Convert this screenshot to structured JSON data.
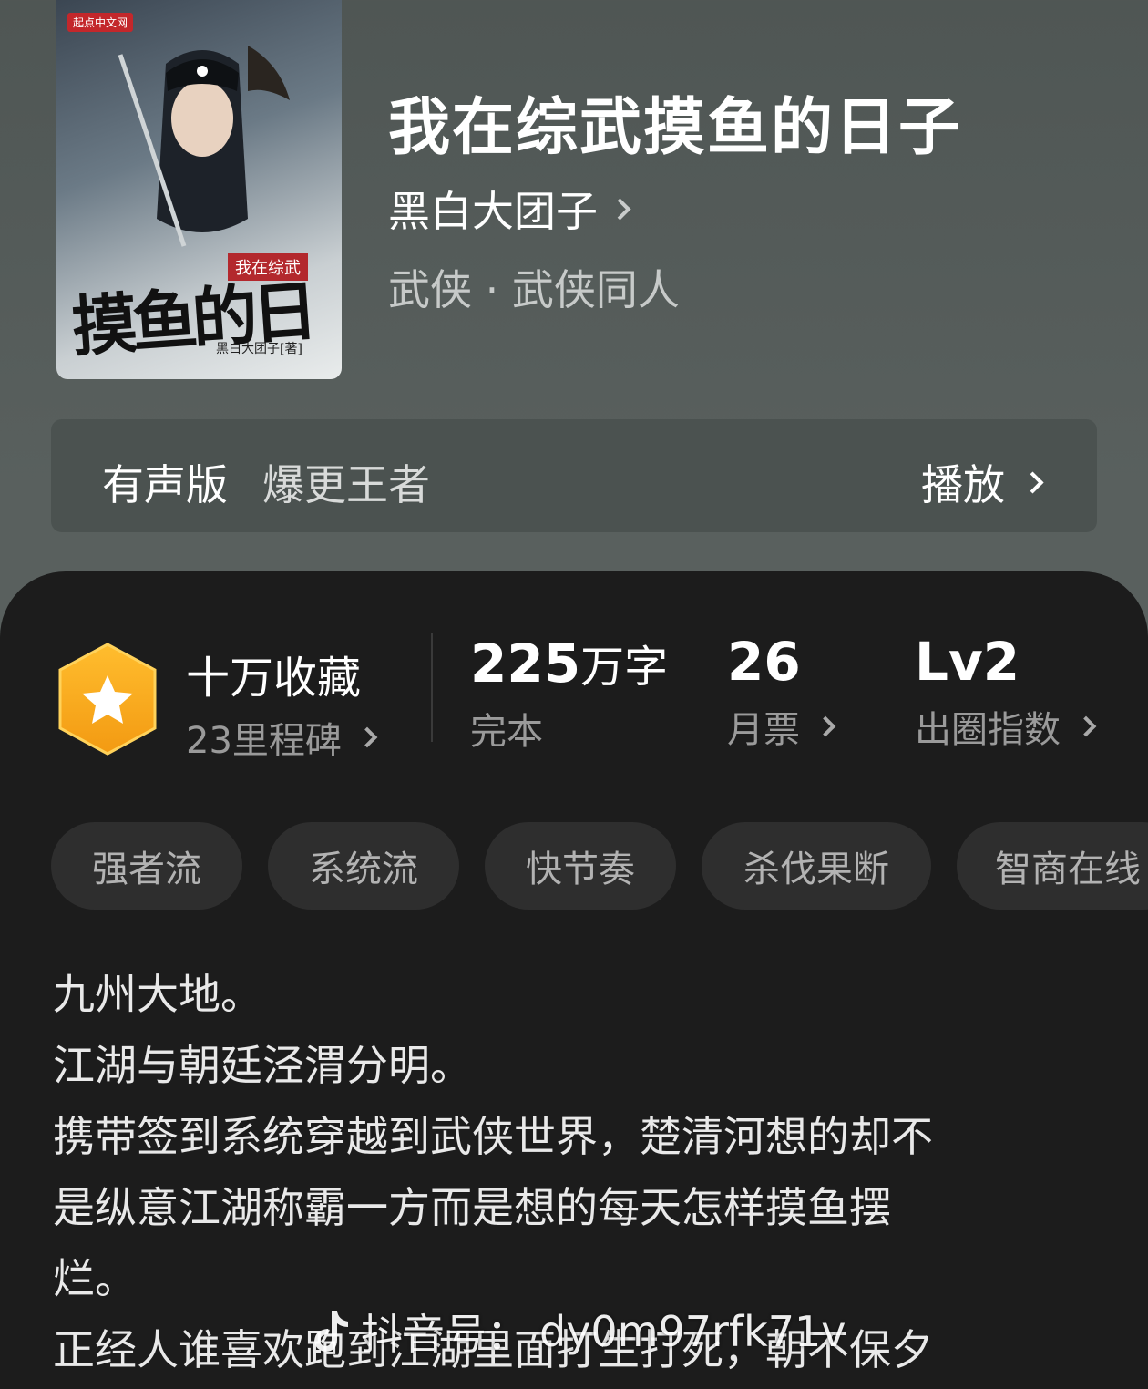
{
  "book": {
    "title": "我在综武摸鱼的日子",
    "author": "黑白大团子",
    "genre": "武侠 · 武侠同人",
    "cover": {
      "publisher": "起点中文网",
      "subtitle": "我在综武",
      "big_title": "摸鱼的日子",
      "author_line": "黑白大团子[著]"
    }
  },
  "audio": {
    "label": "有声版",
    "description": "爆更王者",
    "play_label": "播放"
  },
  "stats": {
    "collections": {
      "title": "十万收藏",
      "sub": "23里程碑"
    },
    "words": {
      "value": "225",
      "unit": "万字",
      "sub": "完本"
    },
    "monthly_votes": {
      "value": "26",
      "sub": "月票"
    },
    "index": {
      "value": "Lv2",
      "sub": "出圈指数"
    }
  },
  "tags": [
    "强者流",
    "系统流",
    "快节奏",
    "杀伐果断",
    "智商在线"
  ],
  "description_lines": [
    "九州大地。",
    "江湖与朝廷泾渭分明。",
    "携带签到系统穿越到武侠世界，楚清河想的却不",
    "是纵意江湖称霸一方而是想的每天怎样摸鱼摆",
    "烂。",
    "正经人谁喜欢跑到江湖里面打生打死，朝不保夕"
  ],
  "watermark": {
    "label": "抖音号：",
    "id": "dy0m97rfk71v"
  },
  "colors": {
    "panel_bg": "#1c1c1c",
    "badge_orange": "#f7a51b",
    "tag_bg": "#2e2e2e"
  }
}
